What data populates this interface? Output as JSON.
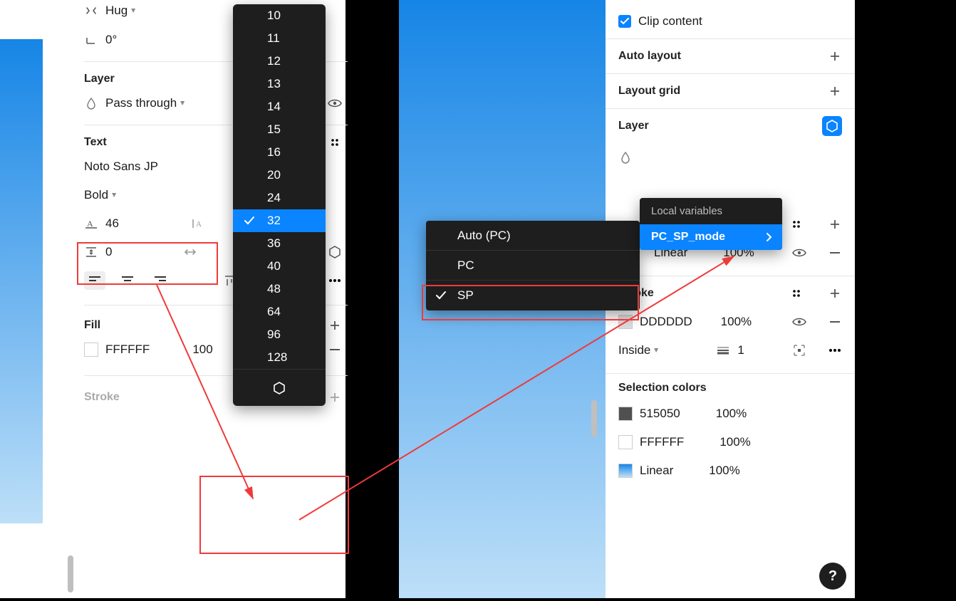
{
  "left": {
    "hug_label": "Hug",
    "rotation": "0°",
    "layer": {
      "title": "Layer",
      "blend": "Pass through"
    },
    "text": {
      "title": "Text",
      "font": "Noto Sans JP",
      "weight": "Bold",
      "line_height": "46",
      "letter_spacing": "0",
      "selected_size": "32"
    },
    "fill": {
      "title": "Fill",
      "color_hex": "FFFFFF",
      "opacity": "100"
    },
    "stroke_title": "Stroke",
    "size_dropdown": [
      "10",
      "11",
      "12",
      "13",
      "14",
      "15",
      "16",
      "20",
      "24",
      "32",
      "36",
      "40",
      "48",
      "64",
      "96",
      "128"
    ]
  },
  "right": {
    "clip_content": "Clip content",
    "auto_layout": "Auto layout",
    "layout_grid": "Layout grid",
    "layer_title": "Layer",
    "fill_row": {
      "type": "Linear",
      "opacity": "100%"
    },
    "stroke": {
      "title": "Stroke",
      "color_hex": "DDDDDD",
      "opacity": "100%",
      "position": "Inside",
      "weight": "1"
    },
    "selection_colors": {
      "title": "Selection colors",
      "rows": [
        {
          "hex": "515050",
          "op": "100%"
        },
        {
          "hex": "FFFFFF",
          "op": "100%"
        },
        {
          "hex": "Linear",
          "op": "100%"
        }
      ]
    },
    "mode_menu": {
      "auto": "Auto (PC)",
      "pc": "PC",
      "sp": "SP"
    },
    "var_menu": {
      "header": "Local variables",
      "item": "PC_SP_mode"
    }
  }
}
